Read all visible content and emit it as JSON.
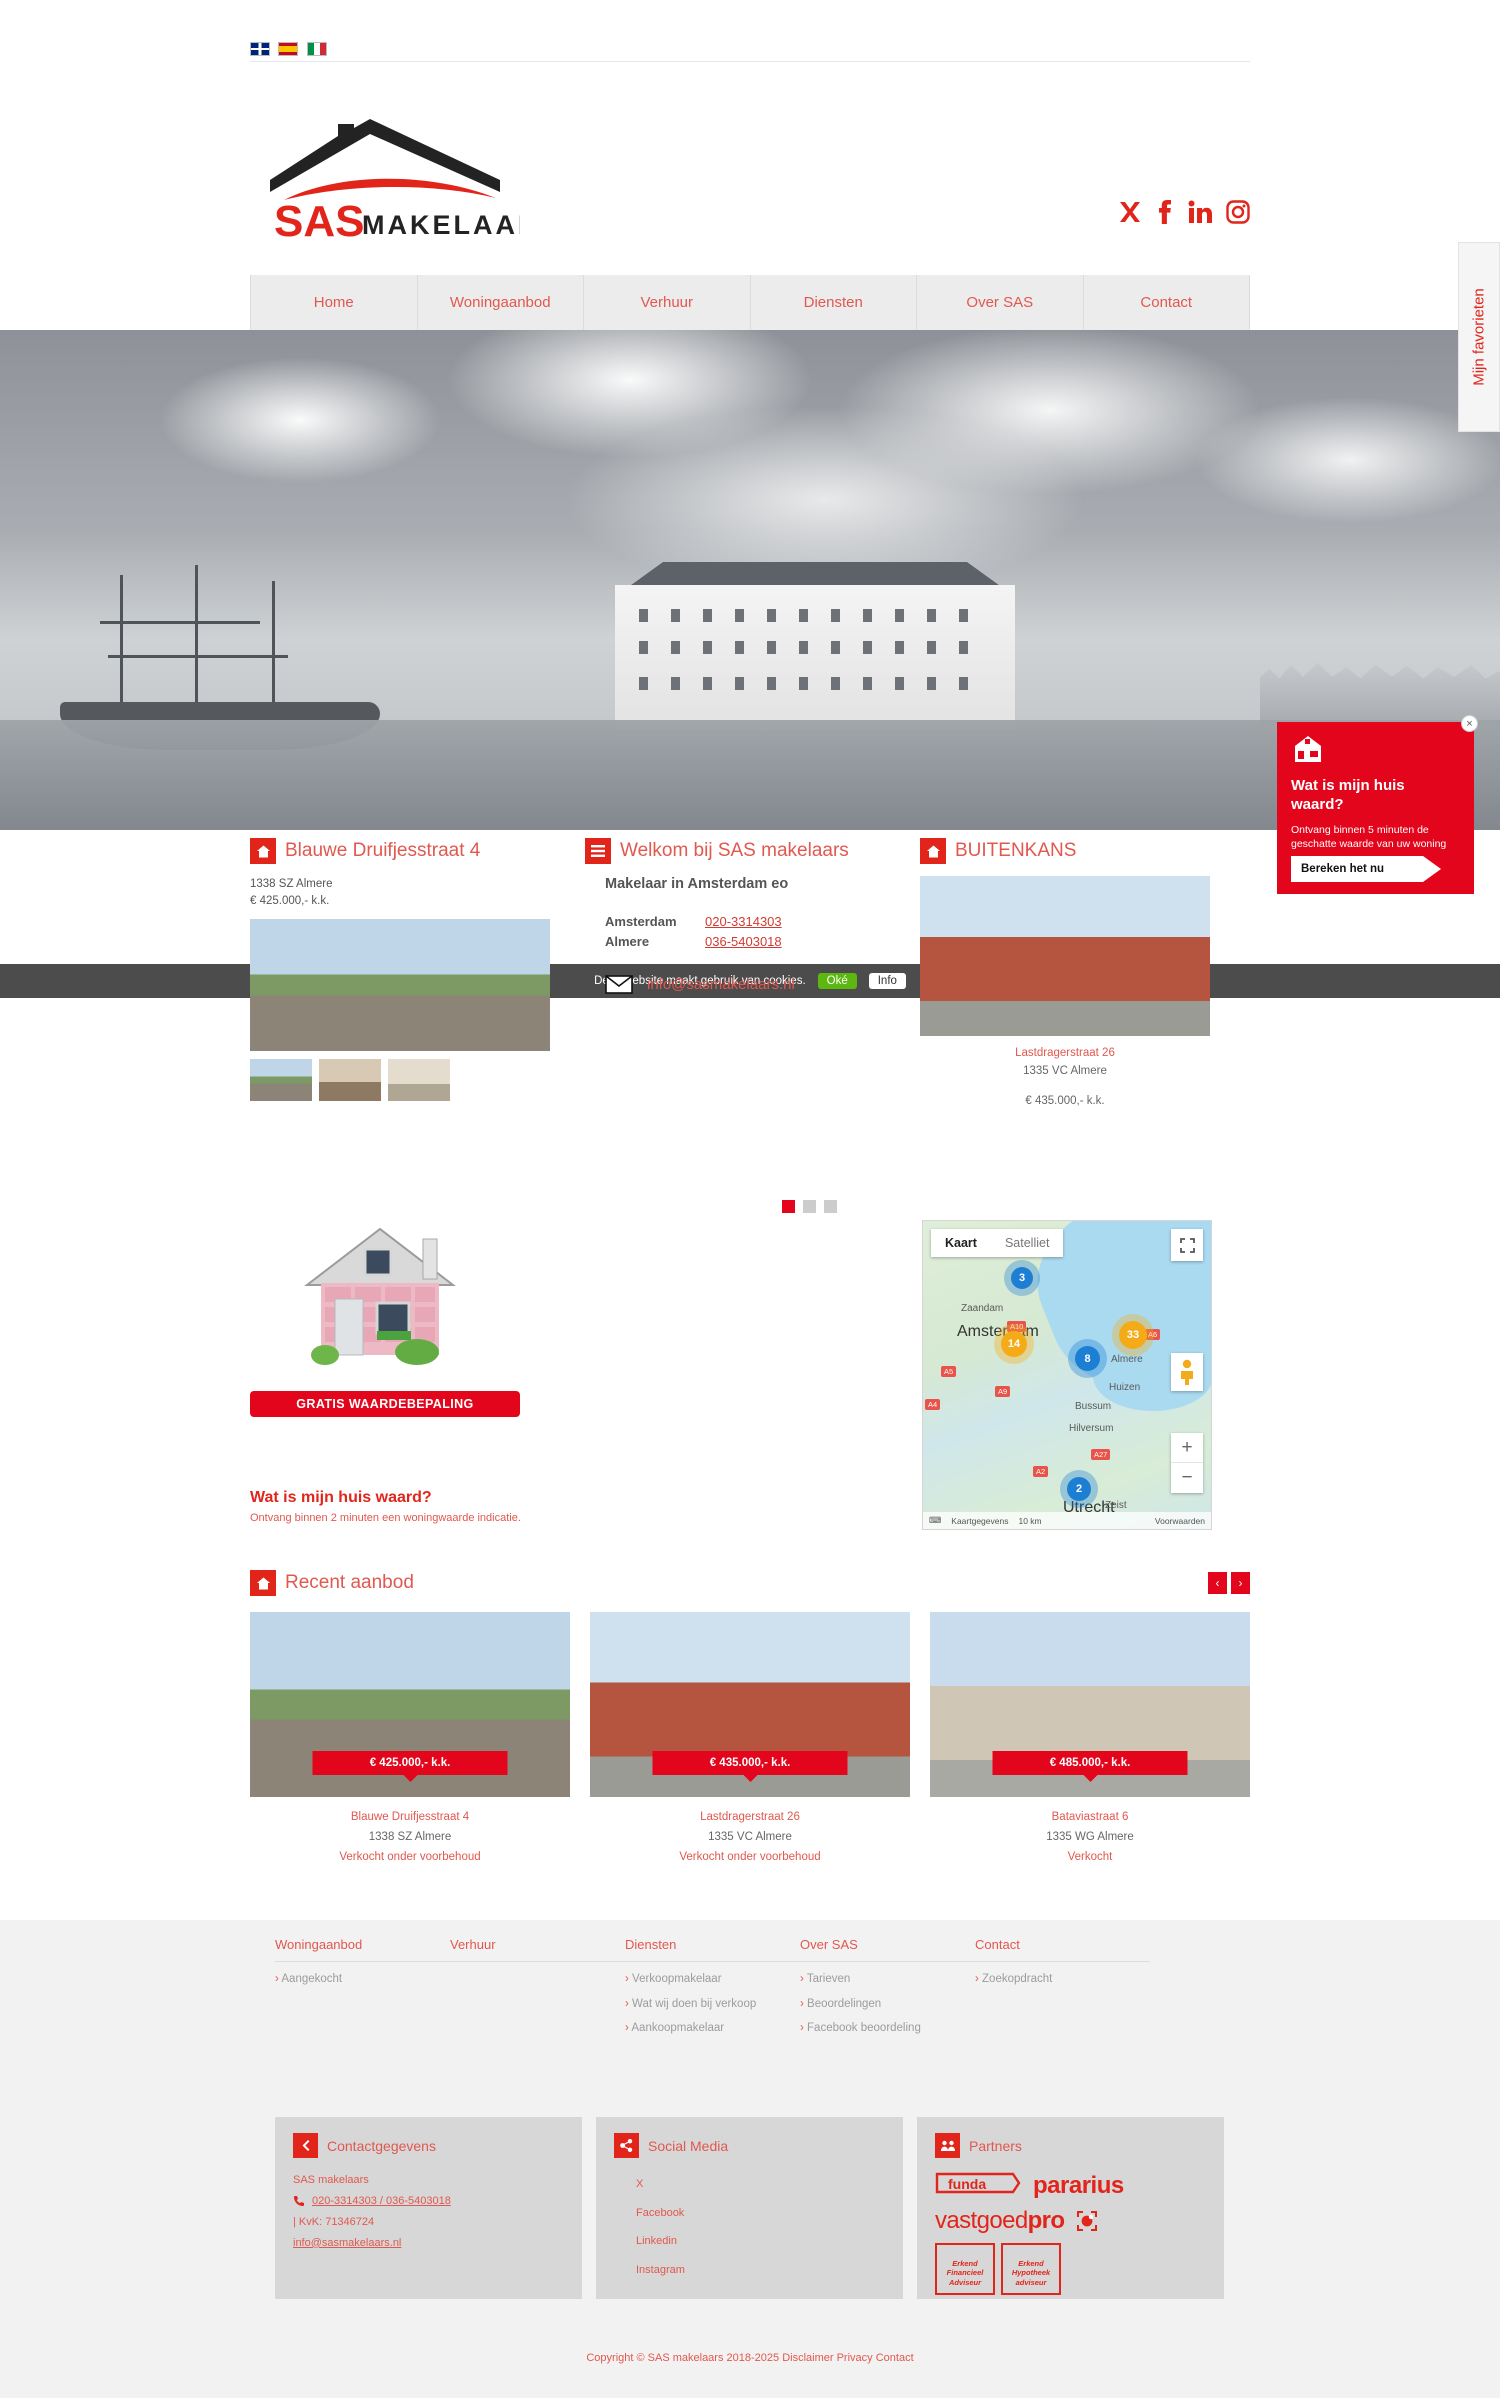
{
  "languages": [
    {
      "name": "flag-uk-icon",
      "label": "English"
    },
    {
      "name": "flag-es-icon",
      "label": "Espanol"
    },
    {
      "name": "flag-it-icon",
      "label": "Italiano"
    }
  ],
  "brand": {
    "name_red": "SAS",
    "name_black": "MAKELAARS"
  },
  "social_header": [
    {
      "icon": "x-twitter-icon",
      "label": "X"
    },
    {
      "icon": "facebook-icon",
      "label": "Facebook"
    },
    {
      "icon": "linkedin-icon",
      "label": "LinkedIn"
    },
    {
      "icon": "instagram-icon",
      "label": "Instagram"
    }
  ],
  "nav": [
    {
      "label": "Home"
    },
    {
      "label": "Woningaanbod"
    },
    {
      "label": "Verhuur"
    },
    {
      "label": "Diensten"
    },
    {
      "label": "Over SAS"
    },
    {
      "label": "Contact"
    }
  ],
  "favorites_tab": {
    "label": "Mijn favorieten"
  },
  "popup": {
    "close": "×",
    "title": "Wat is mijn huis waard?",
    "text": "Ontvang binnen 5 minuten de geschatte waarde van uw woning",
    "cta": "Bereken het nu"
  },
  "cookiebar": {
    "text": "Deze website maakt gebruik van cookies.",
    "accept": "Oké",
    "info": "Info"
  },
  "featured": {
    "title": "Blauwe Druifjesstraat 4",
    "postcode": "1338 SZ Almere",
    "price": "€ 425.000,- k.k."
  },
  "welkom": {
    "title": "Welkom bij SAS makelaars",
    "subtitle": "Makelaar in Amsterdam eo",
    "contacts": [
      {
        "city": "Amsterdam",
        "phone": "020-3314303"
      },
      {
        "city": "Almere",
        "phone": "036-5403018"
      }
    ],
    "email": "info@sasmakelaars.nl"
  },
  "buitenkans": {
    "title": "BUITENKANS",
    "street": "Lastdragerstraat 26",
    "postcode": "1335 VC Almere",
    "price": "€ 435.000,- k.k."
  },
  "carousel_dots": [
    true,
    false,
    false
  ],
  "waardebepaling": {
    "badge": "GRATIS WAARDEBEPALING",
    "title": "Wat is mijn huis waard?",
    "subtitle": "Ontvang binnen 2 minuten een woningwaarde indicatie."
  },
  "map": {
    "tab_map": "Kaart",
    "tab_satellite": "Satelliet",
    "zoom_in": "+",
    "zoom_out": "−",
    "clusters": [
      {
        "count": "3",
        "color": "blue"
      },
      {
        "count": "14",
        "color": "yellow"
      },
      {
        "count": "33",
        "color": "yellow"
      },
      {
        "count": "8",
        "color": "blue"
      },
      {
        "count": "2",
        "color": "blue"
      }
    ],
    "places": [
      "Zaandam",
      "Almere",
      "Huizen",
      "Bussum",
      "Hilversum",
      "Zeist"
    ],
    "big_places": [
      "Amsterdam",
      "Utrecht"
    ],
    "roads": [
      "A10",
      "A5",
      "A9",
      "A4",
      "A2",
      "A27",
      "A6"
    ],
    "footer_data": "Kaartgegevens",
    "scale": "10 km",
    "terms": "Voorwaarden"
  },
  "recent": {
    "title": "Recent aanbod",
    "prev": "‹",
    "next": "›",
    "cards": [
      {
        "price": "€ 425.000,- k.k.",
        "street": "Blauwe Druifjesstraat 4",
        "postcode": "1338 SZ Almere",
        "status": "Verkocht onder voorbehoud"
      },
      {
        "price": "€ 435.000,- k.k.",
        "street": "Lastdragerstraat 26",
        "postcode": "1335 VC Almere",
        "status": "Verkocht onder voorbehoud"
      },
      {
        "price": "€ 485.000,- k.k.",
        "street": "Bataviastraat 6",
        "postcode": "1335 WG Almere",
        "status": "Verkocht"
      }
    ]
  },
  "footer_columns": [
    {
      "title": "Woningaanbod",
      "links": [
        "Aangekocht"
      ]
    },
    {
      "title": "Verhuur",
      "links": []
    },
    {
      "title": "Diensten",
      "links": [
        "Verkoopmakelaar",
        "Wat wij doen bij verkoop",
        "Aankoopmakelaar"
      ]
    },
    {
      "title": "Over SAS",
      "links": [
        "Tarieven",
        "Beoordelingen",
        "Facebook beoordeling"
      ]
    },
    {
      "title": "Contact",
      "links": [
        "Zoekopdracht"
      ]
    }
  ],
  "contact_box": {
    "title": "Contactgegevens",
    "company": "SAS makelaars",
    "phone": "020-3314303 / 036-5403018",
    "kvk": "| KvK: 71346724",
    "email": "info@sasmakelaars.nl"
  },
  "social_box": {
    "title": "Social Media",
    "links": [
      "X",
      "Facebook",
      "Linkedin",
      "Instagram"
    ]
  },
  "partners_box": {
    "title": "Partners",
    "logos": [
      "funda",
      "pararius",
      "vastgoedpro"
    ],
    "badges": [
      {
        "l1": "Erkend",
        "l2": "Financieel",
        "l3": "Adviseur"
      },
      {
        "l1": "Erkend",
        "l2": "Hypotheek",
        "l3": "adviseur"
      }
    ]
  },
  "copyright": {
    "text": "Copyright © SAS makelaars 2018-2025",
    "links": [
      "Disclaimer",
      "Privacy",
      "Contact"
    ]
  },
  "colors": {
    "brand_red": "#e1251b",
    "link_red": "#e1584f",
    "green": "#5cb811"
  }
}
